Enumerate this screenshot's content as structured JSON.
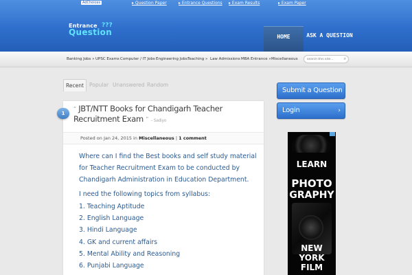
{
  "adbar": {
    "adchoices": "AdChoices",
    "links": [
      "▸ Question Paper",
      "▸ Entrance Questions",
      "▸ Exam Results",
      "▸ Exam Paper"
    ]
  },
  "logo": {
    "line1": "Entrance",
    "line2": "Question",
    "dots": "???"
  },
  "nav": {
    "home": "HOME",
    "ask": "ASK A QUESTION"
  },
  "categories": [
    "Banking Jobs »",
    "UPSC Exams",
    "Computer / IT Jobs",
    "Engineering Jobs",
    "Teaching »",
    "Law Admissions",
    "MBA Entrance »",
    "Miscellaneous"
  ],
  "search": {
    "placeholder": "search this site..."
  },
  "tabs": [
    "Recent",
    "Popular",
    "Unanswered",
    "Random"
  ],
  "post": {
    "number": "1",
    "open_quote": "“",
    "title": "JBT/NTT Books for Chandigarh Teacher Recruitment Exam",
    "close_quote": "”",
    "author": "– Sadiyo",
    "meta_prefix": "Posted on Jan 24, 2015 in",
    "category": "Miscellaneous",
    "separator": "|",
    "comments": "1 comment",
    "body": [
      "Where can I find the Best books and self study material",
      "for Teacher Recruitment Exam to be conducted by",
      "Chandigarh Administration in Education Department.",
      "I need the following topics from syllabus:",
      "1. Teaching Aptitude",
      "2. English Language",
      "3. Hindi Language",
      "4. GK and current affairs",
      "5. Mental Ability and Reasoning",
      "6. Punjabi Language"
    ]
  },
  "sidebar": {
    "submit": "Submit a Question",
    "login": "Login",
    "chevron": "›"
  },
  "ad": {
    "l1": "LEARN",
    "l2": "PHOTO",
    "l3": "GRAPHY",
    "l4": "NEW",
    "l5": "YORK",
    "l6": "FILM"
  },
  "colors": {
    "header": "#2f6fcc",
    "accent": "#5fe3ff",
    "link": "#2a5a92"
  }
}
